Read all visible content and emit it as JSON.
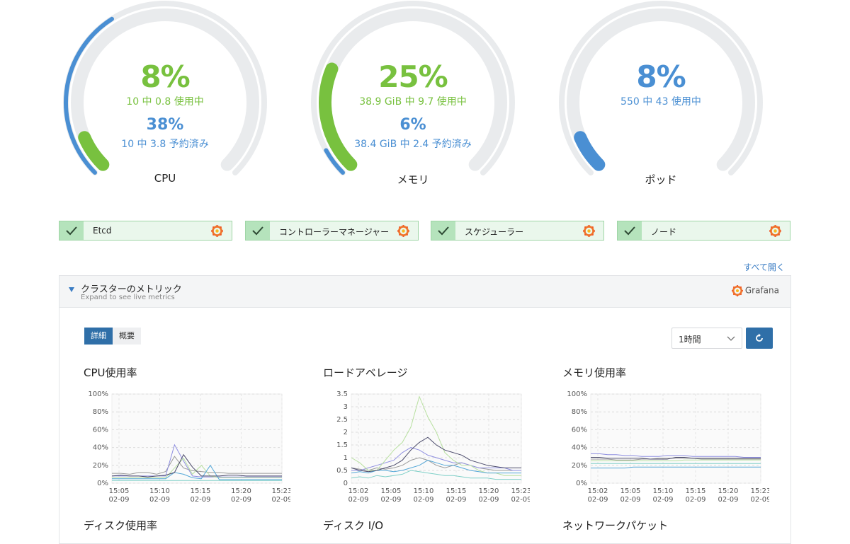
{
  "gauges": [
    {
      "percent": "8%",
      "detail": "10 中 0.8 使用中",
      "percent2": "38%",
      "detail2": "10 中 3.8 予約済み",
      "label": "CPU",
      "used_fraction": 0.08,
      "reserved_fraction": 0.38
    },
    {
      "percent": "25%",
      "detail": "38.9 GiB 中 9.7 使用中",
      "percent2": "6%",
      "detail2": "38.4 GiB 中 2.4 予約済み",
      "label": "メモリ",
      "used_fraction": 0.25,
      "reserved_fraction": 0.06
    },
    {
      "percent": "8%",
      "detail": "550 中 43 使用中",
      "label": "ポッド",
      "used_fraction": 0.08
    }
  ],
  "colors": {
    "used": "#78c13f",
    "reserved": "#4a8fd3",
    "track": "#e9ebed",
    "series": [
      "#9a9a9a",
      "#8e8ee0",
      "#b8e0a0",
      "#55a8d8",
      "#4a4a6a",
      "#7fd0c8"
    ]
  },
  "status": [
    {
      "label": "Etcd",
      "icon": "grafana-icon"
    },
    {
      "label": "コントローラーマネージャー",
      "icon": "grafana-icon"
    },
    {
      "label": "スケジューラー",
      "icon": "grafana-icon"
    },
    {
      "label": "ノード",
      "icon": "grafana-icon"
    }
  ],
  "expand_all": "すべて開く",
  "panel": {
    "title": "クラスターのメトリック",
    "subtitle": "Expand to see live metrics",
    "brand": "Grafana"
  },
  "tabs": [
    "詳細",
    "概要"
  ],
  "range": {
    "value": "1時間"
  },
  "chart_titles": [
    "CPU使用率",
    "ロードアベレージ",
    "メモリ使用率",
    "ディスク使用率",
    "ディスク I/O",
    "ネットワークパケット"
  ],
  "chart_data": [
    {
      "type": "line",
      "title": "CPU使用率",
      "ylim": [
        0,
        100
      ],
      "yticks": [
        "0%",
        "20%",
        "40%",
        "60%",
        "80%",
        "100%"
      ],
      "xticks": [
        "15:05",
        "15:10",
        "15:15",
        "15:20",
        "15:23"
      ],
      "xdate": "02-09",
      "x": [
        0,
        1,
        2,
        3,
        4,
        5,
        6,
        7,
        8,
        9,
        10,
        11,
        12,
        13,
        14,
        15,
        16,
        17,
        18,
        19
      ],
      "series": [
        {
          "values": [
            11,
            11,
            10,
            12,
            12,
            10,
            13,
            30,
            17,
            14,
            13,
            12,
            12,
            11,
            11,
            11,
            11,
            11,
            11,
            11
          ]
        },
        {
          "values": [
            8,
            8,
            8,
            8,
            8,
            8,
            8,
            43,
            25,
            8,
            7,
            7,
            7,
            7,
            7,
            7,
            7,
            7,
            7,
            7
          ]
        },
        {
          "values": [
            6,
            6,
            6,
            6,
            6,
            6,
            6,
            17,
            28,
            10,
            20,
            8,
            6,
            6,
            6,
            6,
            6,
            6,
            6,
            6
          ]
        },
        {
          "values": [
            5,
            5,
            5,
            5,
            5,
            5,
            5,
            12,
            10,
            6,
            5,
            20,
            4,
            4,
            4,
            4,
            4,
            4,
            4,
            4
          ]
        },
        {
          "values": [
            8,
            9,
            8,
            8,
            7,
            8,
            9,
            12,
            32,
            18,
            8,
            8,
            8,
            9,
            9,
            8,
            8,
            8,
            8,
            8
          ]
        },
        {
          "values": [
            3,
            3,
            3,
            3,
            3,
            3,
            3,
            3,
            3,
            3,
            3,
            3,
            3,
            3,
            3,
            3,
            3,
            3,
            3,
            3
          ]
        }
      ]
    },
    {
      "type": "line",
      "title": "ロードアベレージ",
      "ylim": [
        0,
        3.5
      ],
      "yticks": [
        "0",
        "0.5",
        "1",
        "1.5",
        "2",
        "2.5",
        "3",
        "3.5"
      ],
      "xticks": [
        "15:02",
        "15:05",
        "15:10",
        "15:15",
        "15:20",
        "15:23"
      ],
      "xdate": "02-09",
      "x": [
        0,
        1,
        2,
        3,
        4,
        5,
        6,
        7,
        8,
        9,
        10,
        11,
        12,
        13,
        14,
        15,
        16,
        17,
        18,
        19,
        20
      ],
      "series": [
        {
          "values": [
            0.6,
            0.55,
            0.5,
            0.6,
            0.55,
            0.6,
            0.7,
            0.9,
            1.0,
            0.9,
            0.7,
            0.6,
            0.7,
            0.8,
            0.7,
            0.6,
            0.55,
            0.5,
            0.5,
            0.5,
            0.5
          ]
        },
        {
          "values": [
            0.5,
            0.5,
            0.6,
            0.7,
            0.8,
            0.9,
            1.2,
            1.4,
            1.3,
            1.1,
            1.0,
            0.9,
            0.8,
            0.8,
            0.7,
            0.6,
            0.6,
            0.6,
            0.6,
            0.5,
            0.5
          ]
        },
        {
          "values": [
            1.0,
            0.8,
            0.5,
            0.5,
            0.9,
            1.3,
            1.6,
            2.2,
            3.4,
            2.6,
            2.0,
            1.2,
            0.9,
            0.7,
            0.7,
            0.5,
            0.4,
            0.4,
            0.3,
            0.3,
            0.3
          ]
        },
        {
          "values": [
            0.4,
            0.45,
            0.4,
            0.5,
            0.5,
            0.45,
            0.5,
            0.6,
            0.7,
            0.9,
            0.8,
            0.7,
            0.7,
            0.6,
            0.5,
            0.45,
            0.4,
            0.4,
            0.4,
            0.4,
            0.4
          ]
        },
        {
          "values": [
            0.6,
            0.5,
            0.45,
            0.5,
            0.6,
            0.7,
            0.9,
            1.3,
            1.6,
            1.8,
            1.5,
            1.3,
            1.2,
            1.1,
            0.9,
            0.8,
            0.7,
            0.65,
            0.6,
            0.6,
            0.6
          ]
        },
        {
          "values": [
            0.2,
            0.25,
            0.2,
            0.3,
            0.25,
            0.3,
            0.35,
            0.5,
            0.45,
            0.4,
            0.35,
            0.3,
            0.3,
            0.25,
            0.2,
            0.2,
            0.2,
            0.15,
            0.15,
            0.15,
            0.15
          ]
        }
      ]
    },
    {
      "type": "line",
      "title": "メモリ使用率",
      "ylim": [
        0,
        100
      ],
      "yticks": [
        "0%",
        "20%",
        "40%",
        "60%",
        "80%",
        "100%"
      ],
      "xticks": [
        "15:02",
        "15:05",
        "15:10",
        "15:15",
        "15:20",
        "15:23"
      ],
      "xdate": "02-09",
      "x": [
        0,
        1,
        2,
        3,
        4,
        5,
        6,
        7,
        8,
        9,
        10,
        11,
        12,
        13,
        14,
        15,
        16,
        17,
        18,
        19,
        20
      ],
      "series": [
        {
          "values": [
            27,
            27,
            27,
            26,
            26,
            26,
            27,
            27,
            28,
            28,
            28,
            28,
            28,
            27,
            27,
            27,
            27,
            27,
            27,
            27,
            27
          ]
        },
        {
          "values": [
            33,
            33,
            32,
            32,
            31,
            31,
            30,
            30,
            30,
            31,
            31,
            31,
            30,
            30,
            30,
            30,
            30,
            30,
            29,
            29,
            29
          ]
        },
        {
          "values": [
            25,
            25,
            25,
            25,
            25,
            25,
            25,
            25,
            25,
            25,
            25,
            26,
            26,
            26,
            26,
            26,
            26,
            26,
            26,
            26,
            26
          ]
        },
        {
          "values": [
            17,
            17,
            17,
            17,
            17,
            18,
            18,
            18,
            18,
            18,
            18,
            18,
            18,
            18,
            18,
            18,
            18,
            18,
            18,
            18,
            18
          ]
        },
        {
          "values": [
            29,
            29,
            28,
            28,
            28,
            28,
            28,
            27,
            27,
            27,
            29,
            29,
            28,
            28,
            28,
            28,
            28,
            28,
            28,
            28,
            28
          ]
        },
        {
          "values": [
            22,
            22,
            22,
            22,
            22,
            22,
            22,
            22,
            22,
            22,
            22,
            22,
            22,
            22,
            22,
            22,
            22,
            22,
            22,
            22,
            22
          ]
        }
      ]
    }
  ]
}
